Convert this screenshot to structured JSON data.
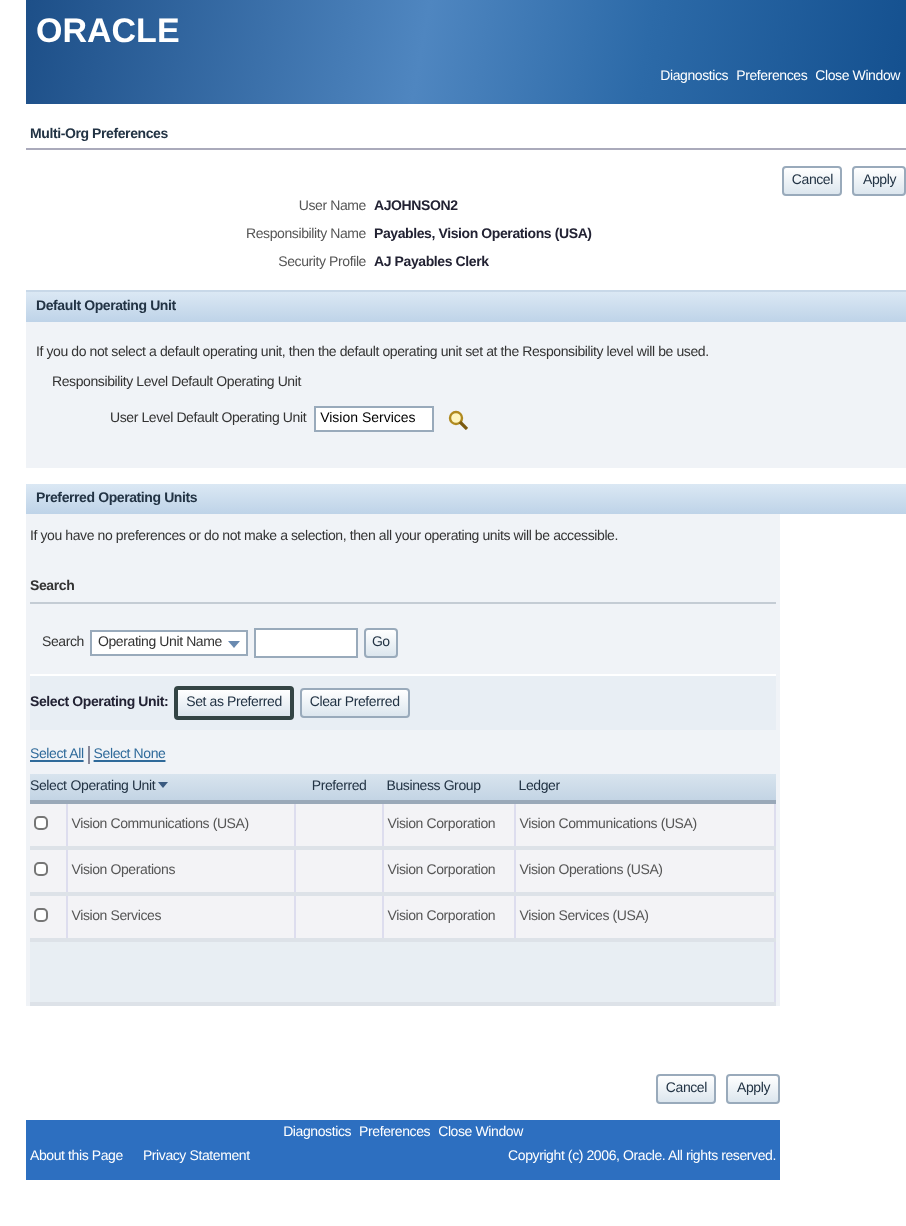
{
  "header": {
    "logo": "ORACLE",
    "links": [
      "Diagnostics",
      "Preferences",
      "Close Window"
    ]
  },
  "page_title": "Multi-Org Preferences",
  "top_buttons": [
    "Cancel",
    "Apply"
  ],
  "info": [
    {
      "label": "User Name",
      "value": "AJOHNSON2"
    },
    {
      "label": "Responsibility Name",
      "value": "Payables, Vision Operations (USA)"
    },
    {
      "label": "Security Profile",
      "value": "AJ Payables Clerk"
    }
  ],
  "default_section": {
    "title": "Default Operating Unit",
    "note": "If you do not select a default operating unit, then the default operating unit set at the Responsibility level will be used.",
    "resp_label": "Responsibility Level Default Operating Unit",
    "user_label": "User Level Default Operating Unit",
    "user_value": "Vision Services"
  },
  "preferred_section": {
    "title": "Preferred Operating Units",
    "note": "If you have no preferences or do not make a selection, then all your operating units will be accessible.",
    "search_title": "Search",
    "search_label": "Search",
    "search_by": "Operating Unit Name",
    "go": "Go",
    "select_label": "Select Operating Unit:",
    "select_buttons": [
      "Set as Preferred",
      "Clear Preferred"
    ],
    "select_all": "Select All",
    "select_none": "Select None"
  },
  "table": {
    "columns": [
      "Select",
      "Operating Unit",
      "Preferred",
      "Business Group",
      "Ledger"
    ],
    "rows": [
      {
        "checked": false,
        "unit": "Vision Communications (USA)",
        "group": "Vision Corporation",
        "ledger": "Vision Communications (USA)"
      },
      {
        "checked": false,
        "unit": "Vision Operations",
        "group": "Vision Corporation",
        "ledger": "Vision Operations (USA)"
      },
      {
        "checked": false,
        "unit": "Vision Services",
        "group": "Vision Corporation",
        "ledger": "Vision Services (USA)"
      }
    ]
  },
  "bottom_buttons": [
    "Cancel",
    "Apply"
  ],
  "footer": {
    "links": [
      "Diagnostics",
      "Preferences",
      "Close Window"
    ],
    "left": [
      "About this Page",
      "Privacy Statement"
    ],
    "copyright": "Copyright (c) 2006, Oracle. All rights reserved."
  }
}
